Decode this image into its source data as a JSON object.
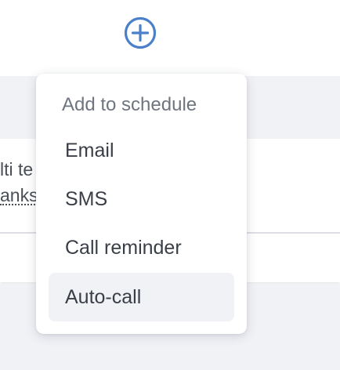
{
  "background": {
    "peek_line_1": "lti te",
    "peek_line_2": "anks"
  },
  "toolbar": {
    "add_icon": "plus-circle-icon",
    "accent_color": "#4a7fc9"
  },
  "menu": {
    "header": "Add to schedule",
    "items": [
      {
        "label": "Email",
        "highlighted": false
      },
      {
        "label": "SMS",
        "highlighted": false
      },
      {
        "label": "Call reminder",
        "highlighted": false
      },
      {
        "label": "Auto-call",
        "highlighted": true
      }
    ]
  }
}
